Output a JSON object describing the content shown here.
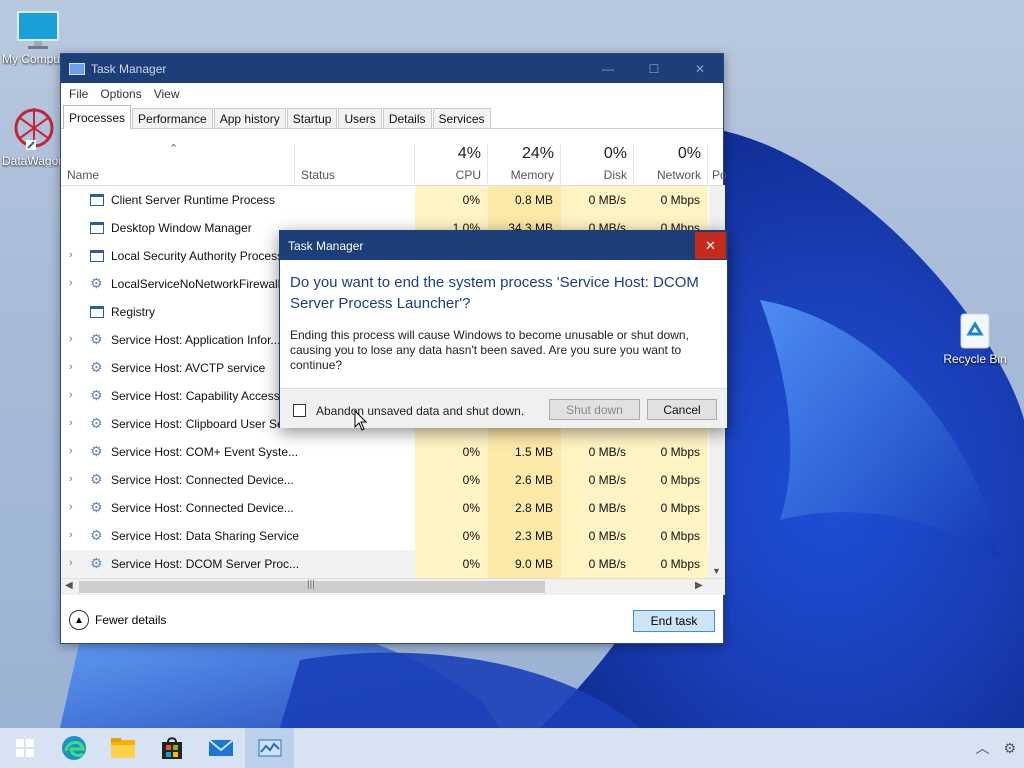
{
  "desktop": {
    "icons": [
      {
        "label": "My Computer"
      },
      {
        "label": "DataWagon"
      },
      {
        "label": "Recycle Bin"
      }
    ]
  },
  "task_manager": {
    "title": "Task Manager",
    "menu": [
      "File",
      "Options",
      "View"
    ],
    "tabs": [
      "Processes",
      "Performance",
      "App history",
      "Startup",
      "Users",
      "Details",
      "Services"
    ],
    "active_tab": "Processes",
    "columns": {
      "name": "Name",
      "status": "Status",
      "cpu": {
        "pct": "4%",
        "label": "CPU"
      },
      "memory": {
        "pct": "24%",
        "label": "Memory"
      },
      "disk": {
        "pct": "0%",
        "label": "Disk"
      },
      "network": {
        "pct": "0%",
        "label": "Network"
      },
      "power": "Po"
    },
    "rows": [
      {
        "name": "Client Server Runtime Process",
        "expandable": false,
        "icon": "window-icon",
        "cpu": "0%",
        "memory": "0.8 MB",
        "disk": "0 MB/s",
        "network": "0 Mbps"
      },
      {
        "name": "Desktop Window Manager",
        "expandable": false,
        "icon": "window-icon",
        "cpu": "1.0%",
        "memory": "34.3 MB",
        "disk": "0 MB/s",
        "network": "0 Mbps"
      },
      {
        "name": "Local Security Authority Process",
        "expandable": true,
        "icon": "window-icon",
        "cpu": "",
        "memory": "",
        "disk": "",
        "network": ""
      },
      {
        "name": "LocalServiceNoNetworkFirewall",
        "expandable": true,
        "icon": "gear-icon",
        "cpu": "",
        "memory": "",
        "disk": "",
        "network": ""
      },
      {
        "name": "Registry",
        "expandable": false,
        "icon": "window-icon",
        "cpu": "",
        "memory": "",
        "disk": "",
        "network": ""
      },
      {
        "name": "Service Host: Application Infor...",
        "expandable": true,
        "icon": "gear-icon",
        "cpu": "",
        "memory": "",
        "disk": "",
        "network": ""
      },
      {
        "name": "Service Host: AVCTP service",
        "expandable": true,
        "icon": "gear-icon",
        "cpu": "",
        "memory": "",
        "disk": "",
        "network": ""
      },
      {
        "name": "Service Host: Capability Access ...",
        "expandable": true,
        "icon": "gear-icon",
        "cpu": "",
        "memory": "",
        "disk": "",
        "network": ""
      },
      {
        "name": "Service Host: Clipboard User Ser...",
        "expandable": true,
        "icon": "gear-icon",
        "cpu": "",
        "memory": "",
        "disk": "",
        "network": ""
      },
      {
        "name": "Service Host: COM+ Event Syste...",
        "expandable": true,
        "icon": "gear-icon",
        "cpu": "0%",
        "memory": "1.5 MB",
        "disk": "0 MB/s",
        "network": "0 Mbps"
      },
      {
        "name": "Service Host: Connected Device...",
        "expandable": true,
        "icon": "gear-icon",
        "cpu": "0%",
        "memory": "2.6 MB",
        "disk": "0 MB/s",
        "network": "0 Mbps"
      },
      {
        "name": "Service Host: Connected Device...",
        "expandable": true,
        "icon": "gear-icon",
        "cpu": "0%",
        "memory": "2.8 MB",
        "disk": "0 MB/s",
        "network": "0 Mbps"
      },
      {
        "name": "Service Host: Data Sharing Service",
        "expandable": true,
        "icon": "gear-icon",
        "cpu": "0%",
        "memory": "2.3 MB",
        "disk": "0 MB/s",
        "network": "0 Mbps"
      },
      {
        "name": "Service Host: DCOM Server Proc...",
        "expandable": true,
        "icon": "gear-icon",
        "cpu": "0%",
        "memory": "9.0 MB",
        "disk": "0 MB/s",
        "network": "0 Mbps",
        "selected": true
      }
    ],
    "fewer_details": "Fewer details",
    "end_task": "End task"
  },
  "dialog": {
    "title": "Task Manager",
    "heading": "Do you want to end the system process 'Service Host: DCOM Server Process Launcher'?",
    "body": "Ending this process will cause Windows to become unusable or shut down, causing you to lose any data hasn't been saved. Are you sure you want to continue?",
    "checkbox_label": "Abandon unsaved data and shut down.",
    "checkbox_checked": false,
    "shutdown_label": "Shut down",
    "cancel_label": "Cancel",
    "close_glyph": "✕"
  },
  "taskbar": {
    "items": [
      "start-icon",
      "edge-icon",
      "file-explorer-icon",
      "store-icon",
      "mail-icon",
      "task-manager-icon"
    ],
    "active": "task-manager-icon",
    "tray": [
      "chevron-up-icon",
      "gear-icon"
    ]
  },
  "colors": {
    "title_bar": "#1c3f7a",
    "close_red": "#c42b1c",
    "heat_light": "#fff4c4",
    "heat_mid": "#fde9a8",
    "end_task_bg": "#cce4f7"
  }
}
